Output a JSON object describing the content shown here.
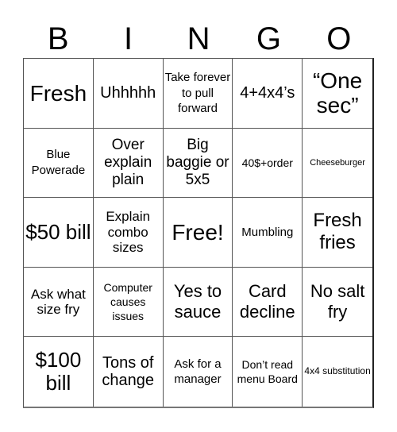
{
  "header": {
    "letters": [
      "B",
      "I",
      "N",
      "G",
      "O"
    ]
  },
  "cells": [
    "Fresh",
    "Uhhhhh",
    "Take forever to pull forward",
    "4+4x4’s",
    "“One sec”",
    "Blue Powerade",
    "Over explain plain",
    "Big baggie or 5x5",
    "40$+order",
    "Cheeseburger",
    "$50 bill",
    "Explain combo sizes",
    "Free!",
    "Mumbling",
    "Fresh fries",
    "Ask what size fry",
    "Computer causes issues",
    "Yes to sauce",
    "Card decline",
    "No salt fry",
    "$100 bill",
    "Tons of change",
    "Ask for a manager",
    "Don’t read menu Board",
    "4x4 substitution"
  ],
  "free_space": {
    "index": 12,
    "label": "Free!"
  },
  "colors": {
    "text": "#000000",
    "grid_line": "#555555",
    "background": "#ffffff"
  }
}
